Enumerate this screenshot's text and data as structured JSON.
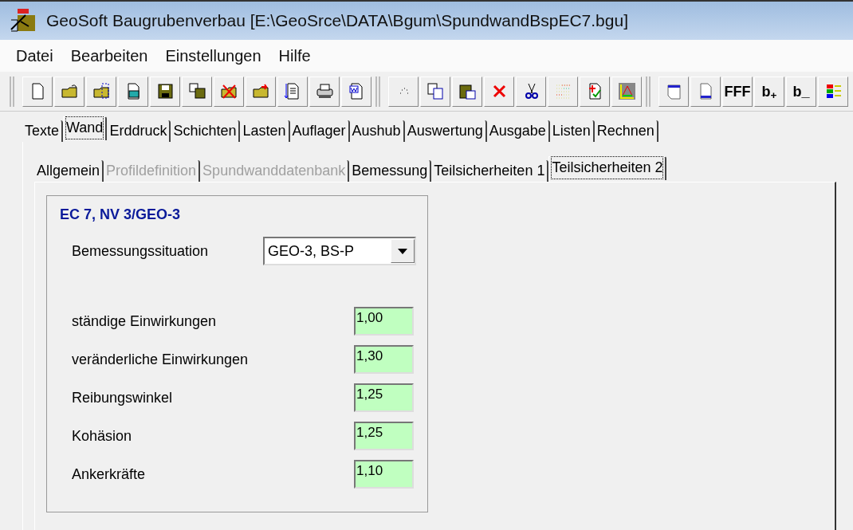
{
  "window": {
    "title": "GeoSoft Baugrubenverbau [E:\\GeoSrce\\DATA\\Bgum\\SpundwandBspEC7.bgu]"
  },
  "menu": [
    "Datei",
    "Bearbeiten",
    "Einstellungen",
    "Hilfe"
  ],
  "toolbar": [
    [
      {
        "kind": "new"
      },
      {
        "kind": "open"
      },
      {
        "kind": "folder-grid"
      },
      {
        "kind": "card"
      },
      {
        "kind": "save"
      },
      {
        "kind": "save-copy"
      },
      {
        "kind": "folder-delete"
      },
      {
        "kind": "folder-export"
      },
      {
        "kind": "doc-arrow"
      },
      {
        "kind": "print"
      },
      {
        "kind": "word"
      }
    ],
    [
      {
        "kind": "dots"
      },
      {
        "kind": "copy"
      },
      {
        "kind": "paste"
      },
      {
        "kind": "delete"
      },
      {
        "kind": "cut"
      },
      {
        "kind": "color-grid"
      },
      {
        "kind": "doc-check"
      },
      {
        "kind": "triangle"
      }
    ],
    [
      {
        "kind": "header"
      },
      {
        "kind": "footer"
      },
      {
        "kind": "text",
        "label": "FFF"
      },
      {
        "kind": "text",
        "label": "b$_{+}$"
      },
      {
        "kind": "text",
        "label": "b_"
      },
      {
        "kind": "bars"
      }
    ]
  ],
  "tabs": [
    {
      "label": "Texte",
      "selected": false
    },
    {
      "label": "Wand",
      "selected": true
    },
    {
      "label": "Erddruck",
      "selected": false
    },
    {
      "label": "Schichten",
      "selected": false
    },
    {
      "label": "Lasten",
      "selected": false
    },
    {
      "label": "Auflager",
      "selected": false
    },
    {
      "label": "Aushub",
      "selected": false
    },
    {
      "label": "Auswertung",
      "selected": false
    },
    {
      "label": "Ausgabe",
      "selected": false
    },
    {
      "label": "Listen",
      "selected": false
    },
    {
      "label": "Rechnen",
      "selected": false
    }
  ],
  "subtabs": [
    {
      "label": "Allgemein",
      "selected": false,
      "disabled": false
    },
    {
      "label": "Profildefinition",
      "selected": false,
      "disabled": true
    },
    {
      "label": "Spundwanddatenbank",
      "selected": false,
      "disabled": true
    },
    {
      "label": "Bemessung",
      "selected": false,
      "disabled": false
    },
    {
      "label": "Teilsicherheiten 1",
      "selected": false,
      "disabled": false
    },
    {
      "label": "Teilsicherheiten 2",
      "selected": true,
      "disabled": false
    }
  ],
  "group": {
    "title": "EC 7, NV 3/GEO-3",
    "situation": {
      "label": "Bemessungssituation",
      "value": "GEO-3, BS-P"
    },
    "factors": [
      {
        "label": "ständige Einwirkungen",
        "value": "1,00"
      },
      {
        "label": "veränderliche Einwirkungen",
        "value": "1,30"
      },
      {
        "label": "Reibungswinkel",
        "value": "1,25"
      },
      {
        "label": "Kohäsion",
        "value": "1,25"
      },
      {
        "label": "Ankerkräfte",
        "value": "1,10"
      }
    ]
  }
}
